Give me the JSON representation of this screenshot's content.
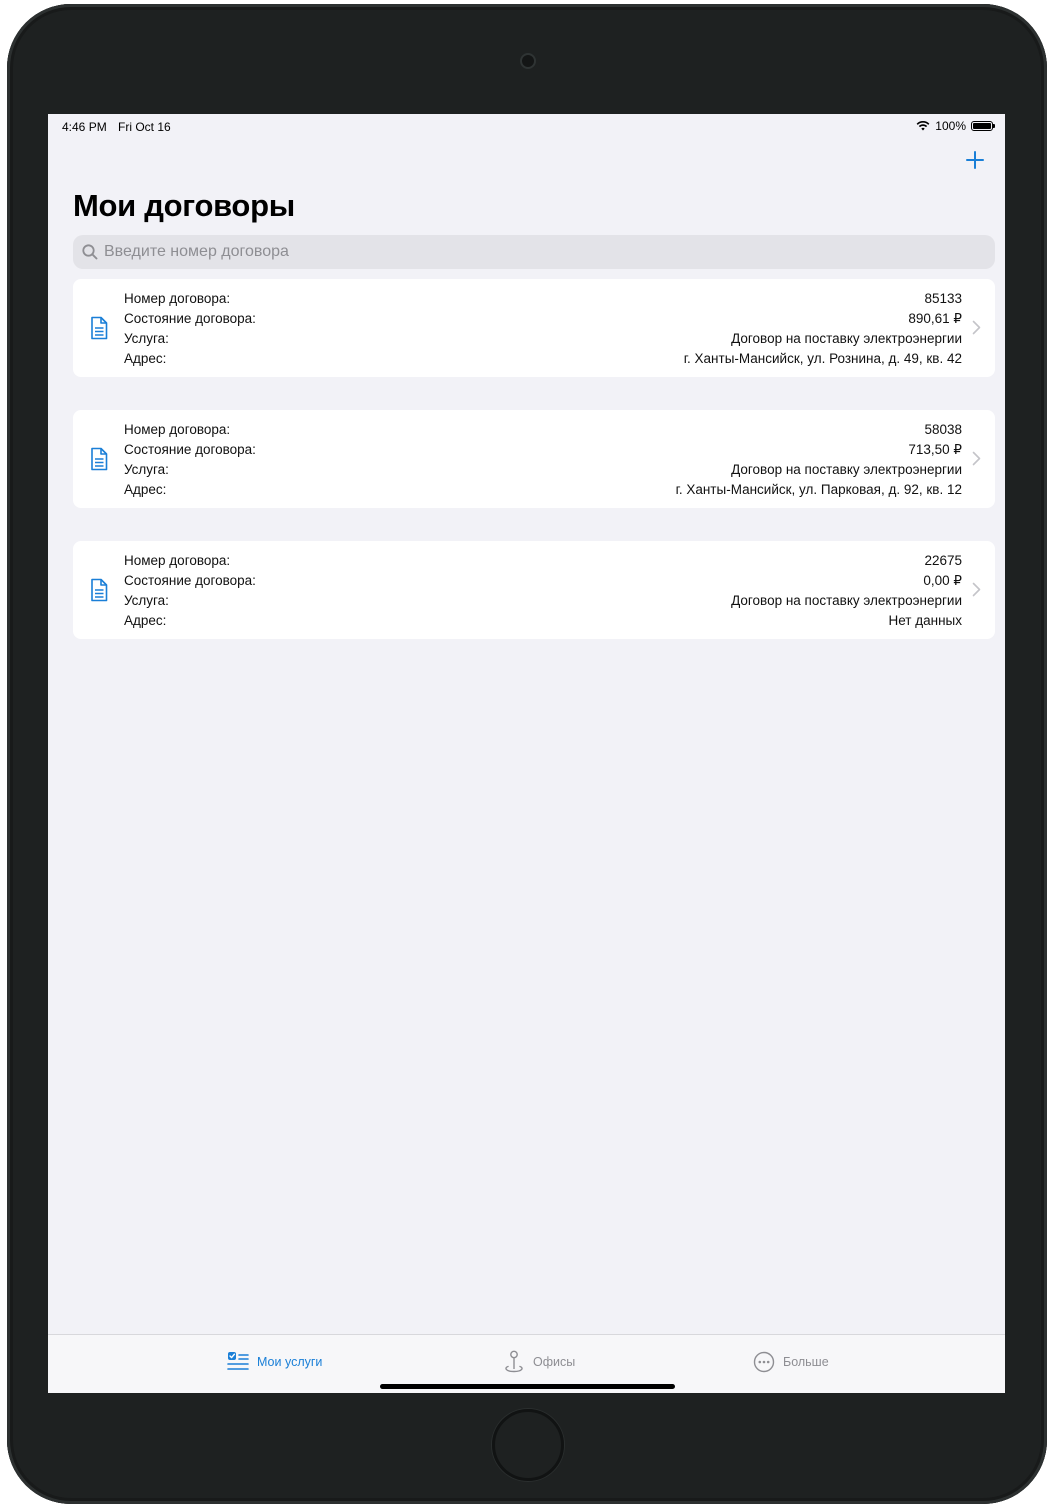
{
  "status_bar": {
    "time": "4:46 PM",
    "date": "Fri Oct 16",
    "battery": "100%"
  },
  "header": {
    "title": "Мои договоры",
    "add_icon": "plus-icon"
  },
  "search": {
    "placeholder": "Введите номер договора",
    "value": ""
  },
  "labels": {
    "number": "Номер договора:",
    "state": "Состояние договора:",
    "service": "Услуга:",
    "address": "Адрес:"
  },
  "contracts": [
    {
      "number": "85133",
      "state": "890,61 ₽",
      "service": "Договор на поставку электроэнергии",
      "address": "г. Ханты-Мансийск, ул. Рознина, д. 49, кв. 42"
    },
    {
      "number": "58038",
      "state": "713,50 ₽",
      "service": "Договор на поставку электроэнергии",
      "address": "г. Ханты-Мансийск, ул. Парковая, д. 92, кв. 12"
    },
    {
      "number": "22675",
      "state": "0,00 ₽",
      "service": "Договор на поставку электроэнергии",
      "address": "Нет данных"
    }
  ],
  "tab_bar": {
    "tabs": [
      {
        "label": "Мои услуги",
        "icon": "checklist-icon",
        "active": true
      },
      {
        "label": "Офисы",
        "icon": "map-pin-icon",
        "active": false
      },
      {
        "label": "Больше",
        "icon": "more-icon",
        "active": false
      }
    ]
  },
  "colors": {
    "accent": "#1a7fd7",
    "background": "#f2f2f7",
    "inactive": "#8e8e93"
  }
}
